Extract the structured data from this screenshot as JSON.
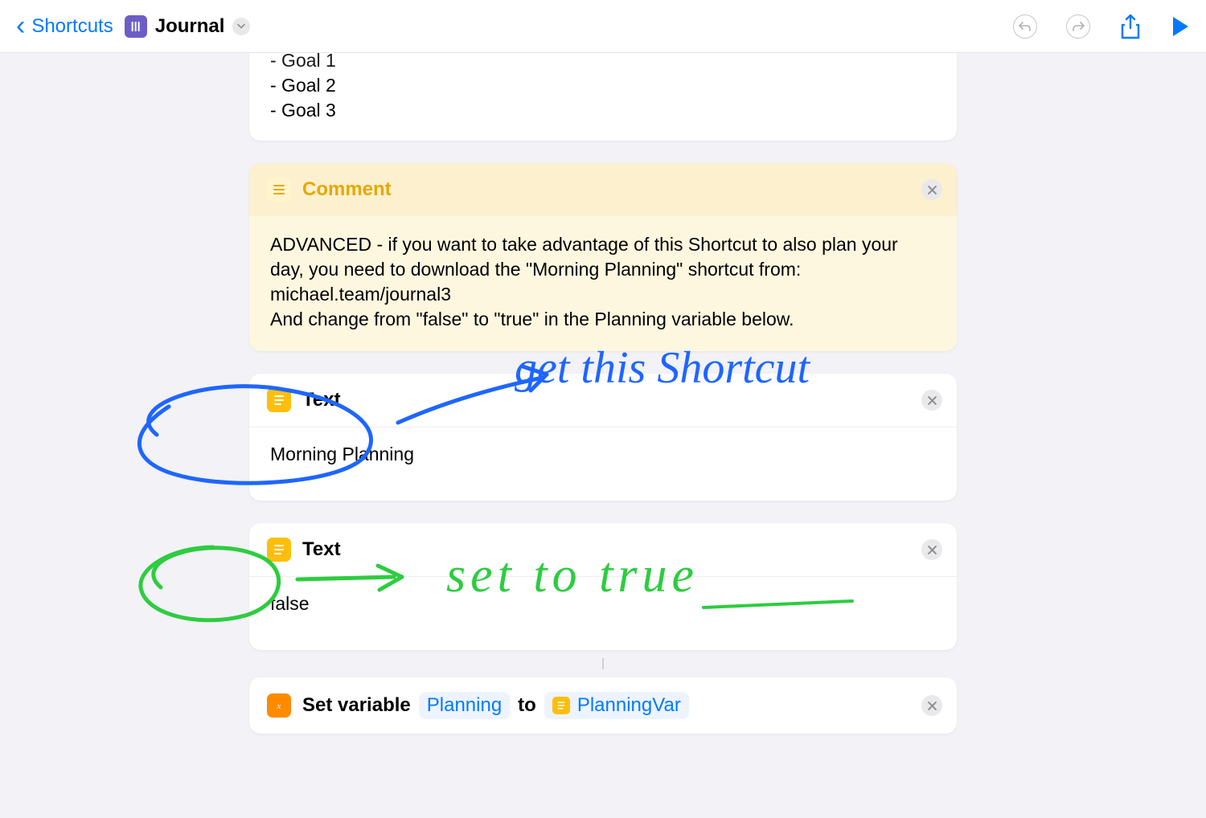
{
  "header": {
    "back_label": "Shortcuts",
    "title": "Journal"
  },
  "goals_card": {
    "line1": "- Goal 1",
    "line2": "- Goal 2",
    "line3": "- Goal 3"
  },
  "comment": {
    "title": "Comment",
    "body": "ADVANCED - if you want to take advantage of this Shortcut to also plan your day, you need to download the \"Morning Planning\" shortcut from: michael.team/journal3\nAnd change from \"false\" to \"true\" in the Planning variable below."
  },
  "text1": {
    "title": "Text",
    "value": "Morning Planning"
  },
  "text2": {
    "title": "Text",
    "value": "false"
  },
  "setvar": {
    "label": "Set variable",
    "var_name": "Planning",
    "to": "to",
    "value_name": "PlanningVar"
  },
  "annotations": {
    "blue_text": "get this Shortcut",
    "green_text": "set to true"
  }
}
